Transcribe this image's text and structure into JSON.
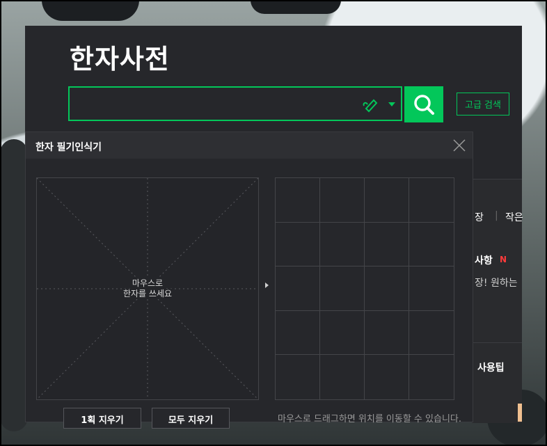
{
  "header": {
    "title": "한자사전"
  },
  "search": {
    "placeholder": "",
    "value": ""
  },
  "advanced_search_label": "고급 검색",
  "right_fragments": {
    "menu_a": "장",
    "menu_b": "작은",
    "notice_title": "사항",
    "notice_badge": "N",
    "notice_text": "장! 원하는",
    "tip_title": "사용팁"
  },
  "handwriting": {
    "title": "한자 필기인식기",
    "canvas_hint_line1": "마우스로",
    "canvas_hint_line2": "한자를 쓰세요",
    "undo_label": "1획 지우기",
    "clear_label": "모두 지우기",
    "drag_hint": "마우스로 드래그하면 위치를 이동할 수 있습니다."
  },
  "colors": {
    "accent": "#03c75a",
    "panel": "#26272b",
    "badge": "#ff3b3b"
  }
}
